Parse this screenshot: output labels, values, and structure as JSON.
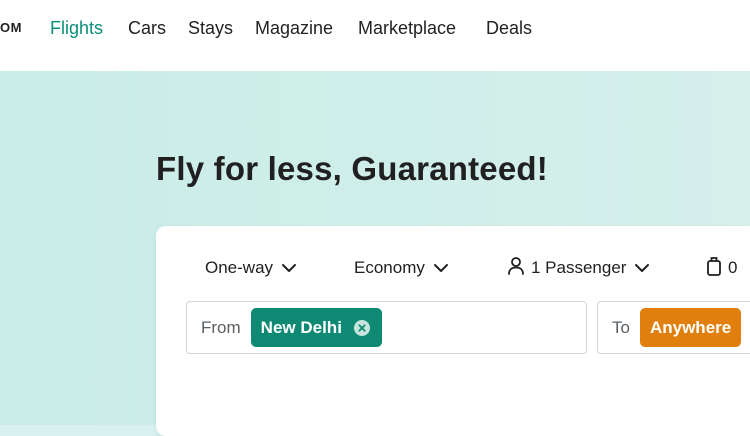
{
  "header": {
    "brand_fragment": "OM",
    "nav": [
      {
        "label": "Flights",
        "active": true
      },
      {
        "label": "Cars",
        "active": false
      },
      {
        "label": "Stays",
        "active": false
      },
      {
        "label": "Magazine",
        "active": false
      },
      {
        "label": "Marketplace",
        "active": false
      },
      {
        "label": "Deals",
        "active": false
      }
    ]
  },
  "hero": {
    "title": "Fly for less, Guaranteed!"
  },
  "search": {
    "trip_type": "One-way",
    "cabin_class": "Economy",
    "passengers": "1 Passenger",
    "bags": "0",
    "from_label": "From",
    "from_value": "New Delhi",
    "to_label": "To",
    "to_value": "Anywhere"
  },
  "colors": {
    "accent": "#0b8f79",
    "from_chip": "#0e8a74",
    "to_chip": "#e07f0c",
    "hero_bg": "#d8f1ee"
  },
  "icons": {
    "dropdown": "chevron-down-icon",
    "passenger": "person-icon",
    "bags": "bag-icon",
    "clear": "clear-circle-icon"
  }
}
